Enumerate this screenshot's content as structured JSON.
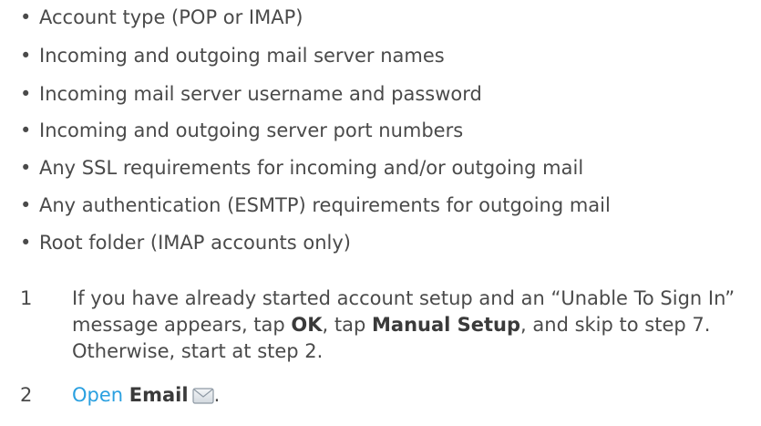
{
  "requirements": [
    "Account type (POP or IMAP)",
    "Incoming and outgoing mail server names",
    "Incoming mail server username and password",
    "Incoming and outgoing server port numbers",
    "Any SSL requirements for incoming and/or outgoing mail",
    "Any authentication (ESMTP) requirements for outgoing mail",
    "Root folder (IMAP accounts only)"
  ],
  "bullet_symbol": "•",
  "step1": {
    "number": "1",
    "part1": "If you have already started account setup and an “Unable To Sign In” message appears, tap ",
    "ok": "OK",
    "part2": ", tap ",
    "manual_setup": "Manual Setup",
    "part3": ", and skip to step 7. Otherwise, start at step 2."
  },
  "step2": {
    "number": "2",
    "open_link": "Open",
    "email": "Email",
    "period": ".",
    "icon": "envelope-icon"
  }
}
